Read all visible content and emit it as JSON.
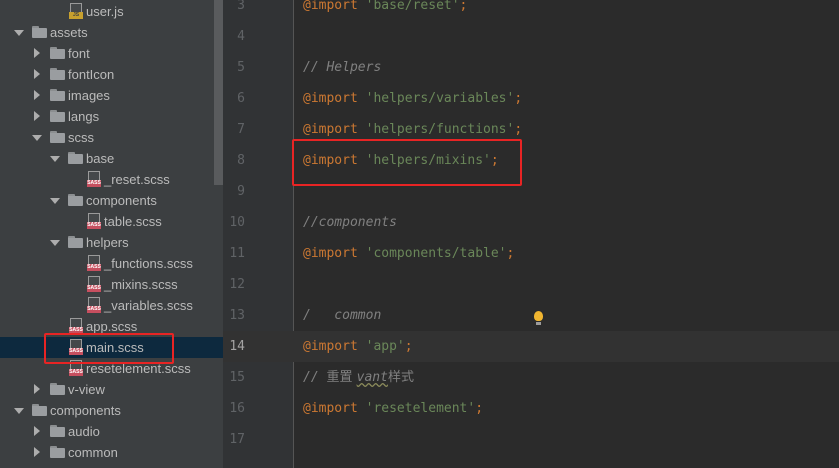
{
  "project_tree": {
    "items": [
      {
        "label": "user.js",
        "type": "file",
        "file_type": "js",
        "file_badge": "JS"
      },
      {
        "label": "assets",
        "type": "folder",
        "expanded": true
      },
      {
        "label": "font",
        "type": "folder",
        "expanded": false
      },
      {
        "label": "fontIcon",
        "type": "folder",
        "expanded": false
      },
      {
        "label": "images",
        "type": "folder",
        "expanded": false
      },
      {
        "label": "langs",
        "type": "folder",
        "expanded": false
      },
      {
        "label": "scss",
        "type": "folder",
        "expanded": true
      },
      {
        "label": "base",
        "type": "folder",
        "expanded": true
      },
      {
        "label": "_reset.scss",
        "type": "file",
        "file_type": "sass",
        "file_badge": "SASS"
      },
      {
        "label": "components",
        "type": "folder",
        "expanded": true
      },
      {
        "label": "table.scss",
        "type": "file",
        "file_type": "sass",
        "file_badge": "SASS"
      },
      {
        "label": "helpers",
        "type": "folder",
        "expanded": true
      },
      {
        "label": "_functions.scss",
        "type": "file",
        "file_type": "sass",
        "file_badge": "SASS"
      },
      {
        "label": "_mixins.scss",
        "type": "file",
        "file_type": "sass",
        "file_badge": "SASS"
      },
      {
        "label": "_variables.scss",
        "type": "file",
        "file_type": "sass",
        "file_badge": "SASS"
      },
      {
        "label": "app.scss",
        "type": "file",
        "file_type": "sass",
        "file_badge": "SASS"
      },
      {
        "label": "main.scss",
        "type": "file",
        "file_type": "sass",
        "file_badge": "SASS",
        "selected": true
      },
      {
        "label": "resetelement.scss",
        "type": "file",
        "file_type": "sass",
        "file_badge": "SASS"
      },
      {
        "label": "v-view",
        "type": "folder",
        "expanded": false
      },
      {
        "label": "components",
        "type": "folder",
        "expanded": true
      },
      {
        "label": "audio",
        "type": "folder",
        "expanded": false
      },
      {
        "label": "common",
        "type": "folder",
        "expanded": false
      }
    ]
  },
  "editor": {
    "current_line": "14",
    "lines": [
      {
        "number": "3",
        "tokens": [
          {
            "kind": "kw",
            "text": "@import"
          },
          {
            "kind": "plain",
            "text": " "
          },
          {
            "kind": "str",
            "text": "'base/reset'"
          },
          {
            "kind": "kw",
            "text": ";"
          }
        ]
      },
      {
        "number": "4",
        "tokens": []
      },
      {
        "number": "5",
        "tokens": [
          {
            "kind": "cmt",
            "text": "// Helpers"
          }
        ]
      },
      {
        "number": "6",
        "tokens": [
          {
            "kind": "kw",
            "text": "@import"
          },
          {
            "kind": "plain",
            "text": " "
          },
          {
            "kind": "str",
            "text": "'helpers/variables'"
          },
          {
            "kind": "kw",
            "text": ";"
          }
        ]
      },
      {
        "number": "7",
        "tokens": [
          {
            "kind": "kw",
            "text": "@import"
          },
          {
            "kind": "plain",
            "text": " "
          },
          {
            "kind": "str",
            "text": "'helpers/functions'"
          },
          {
            "kind": "kw",
            "text": ";"
          }
        ]
      },
      {
        "number": "8",
        "tokens": [
          {
            "kind": "kw",
            "text": "@import"
          },
          {
            "kind": "plain",
            "text": " "
          },
          {
            "kind": "str",
            "text": "'helpers/mixins'"
          },
          {
            "kind": "kw",
            "text": ";"
          }
        ]
      },
      {
        "number": "9",
        "tokens": []
      },
      {
        "number": "10",
        "tokens": [
          {
            "kind": "cmt",
            "text": "//components"
          }
        ]
      },
      {
        "number": "11",
        "tokens": [
          {
            "kind": "kw",
            "text": "@import"
          },
          {
            "kind": "plain",
            "text": " "
          },
          {
            "kind": "str",
            "text": "'components/table'"
          },
          {
            "kind": "kw",
            "text": ";"
          }
        ]
      },
      {
        "number": "12",
        "tokens": []
      },
      {
        "number": "13",
        "tokens": [
          {
            "kind": "cmt",
            "text": "/"
          },
          {
            "kind": "gap",
            "text": "  "
          },
          {
            "kind": "cmt",
            "text": " common"
          }
        ]
      },
      {
        "number": "14",
        "tokens": [
          {
            "kind": "kw",
            "text": "@import"
          },
          {
            "kind": "plain",
            "text": " "
          },
          {
            "kind": "str",
            "text": "'app'"
          },
          {
            "kind": "kw",
            "text": ";"
          }
        ]
      },
      {
        "number": "15",
        "tokens": [
          {
            "kind": "cmt",
            "text": "// "
          },
          {
            "kind": "cmt cjk",
            "text": "重置 "
          },
          {
            "kind": "cmt typo",
            "text": "vant"
          },
          {
            "kind": "cmt cjk",
            "text": "样式"
          }
        ]
      },
      {
        "number": "16",
        "tokens": [
          {
            "kind": "kw",
            "text": "@import"
          },
          {
            "kind": "plain",
            "text": " "
          },
          {
            "kind": "str",
            "text": "'resetelement'"
          },
          {
            "kind": "kw",
            "text": ";"
          }
        ]
      },
      {
        "number": "17",
        "tokens": []
      }
    ]
  },
  "icons": {
    "folder": "folder-icon",
    "sass_file": "sass-file-icon",
    "js_file": "js-file-icon",
    "intention": "lightbulb-icon"
  },
  "colors": {
    "highlight_box": "#e82424",
    "keyword": "#cc7832",
    "string": "#6a8759",
    "comment": "#808080",
    "selection": "#0d293e"
  }
}
